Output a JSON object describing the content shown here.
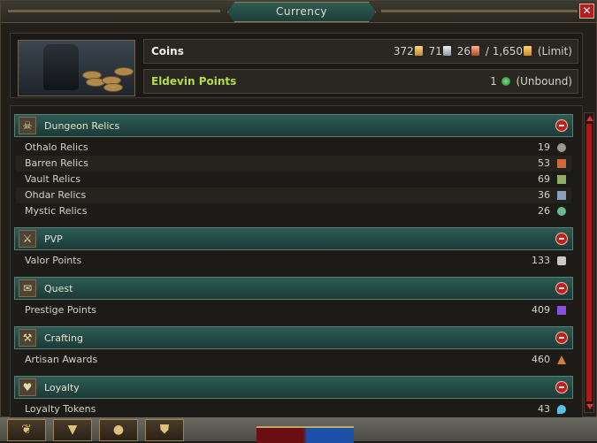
{
  "window": {
    "title": "Currency",
    "close_glyph": "✕"
  },
  "summary": {
    "coins": {
      "label": "Coins",
      "gold": "372",
      "silver": "71",
      "copper": "26",
      "separator": "/",
      "limit_gold": "1,650",
      "limit_note": "(Limit)"
    },
    "eldevin": {
      "label": "Eldevin Points",
      "value": "1",
      "note": "(Unbound)"
    }
  },
  "categories": [
    {
      "label": "Dungeon Relics",
      "icon": "skull-icon",
      "items": [
        {
          "name": "Othalo Relics",
          "count": "19",
          "icon_color": "#9a9a8a"
        },
        {
          "name": "Barren Relics",
          "count": "53",
          "icon_color": "#d06a3a"
        },
        {
          "name": "Vault Relics",
          "count": "69",
          "icon_color": "#8fb06a"
        },
        {
          "name": "Ohdar Relics",
          "count": "36",
          "icon_color": "#8aa0c0"
        },
        {
          "name": "Mystic Relics",
          "count": "26",
          "icon_color": "#6fb890"
        }
      ]
    },
    {
      "label": "PVP",
      "icon": "crossed-swords-icon",
      "items": [
        {
          "name": "Valor Points",
          "count": "133",
          "icon_color": "#c8c8c8"
        }
      ]
    },
    {
      "label": "Quest",
      "icon": "scroll-icon",
      "items": [
        {
          "name": "Prestige Points",
          "count": "409",
          "icon_color": "#8a4fe0"
        }
      ]
    },
    {
      "label": "Crafting",
      "icon": "anvil-icon",
      "items": [
        {
          "name": "Artisan Awards",
          "count": "460",
          "icon_color": "#d97a3a"
        }
      ]
    },
    {
      "label": "Loyalty",
      "icon": "heart-icon",
      "items": [
        {
          "name": "Loyalty Tokens",
          "count": "43",
          "icon_color": "#5ac0e8"
        }
      ]
    }
  ],
  "colors": {
    "category_bg": "#2c5c55",
    "eldevin_label": "#b6dc44",
    "collapse_button": "#c21e1e"
  }
}
